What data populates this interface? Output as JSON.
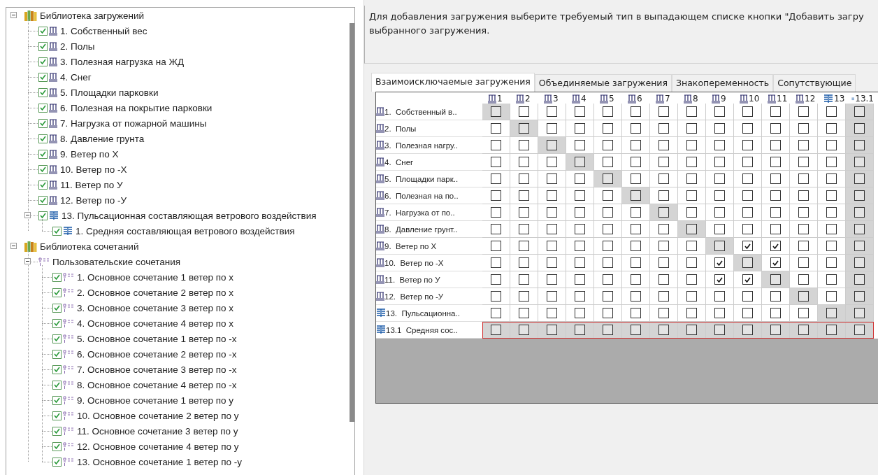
{
  "tree": [
    {
      "label": "Библиотека загружений",
      "kind": "library",
      "expanded": true,
      "children": [
        {
          "label": "1. Собственный вес",
          "kind": "load",
          "checked": true
        },
        {
          "label": "2. Полы",
          "kind": "load",
          "checked": true
        },
        {
          "label": "3. Полезная нагрузка на ЖД",
          "kind": "load",
          "checked": true
        },
        {
          "label": "4. Снег",
          "kind": "load",
          "checked": true
        },
        {
          "label": "5. Площадки парковки",
          "kind": "load",
          "checked": true
        },
        {
          "label": "6. Полезная на покрытие парковки",
          "kind": "load",
          "checked": true
        },
        {
          "label": "7. Нагрузка от пожарной машины",
          "kind": "load",
          "checked": true
        },
        {
          "label": "8. Давление грунта",
          "kind": "load",
          "checked": true
        },
        {
          "label": "9. Ветер по X",
          "kind": "load",
          "checked": true
        },
        {
          "label": "10. Ветер по -X",
          "kind": "load",
          "checked": true
        },
        {
          "label": "11. Ветер по У",
          "kind": "load",
          "checked": true
        },
        {
          "label": "12. Ветер по -У",
          "kind": "load",
          "checked": true
        },
        {
          "label": "13. Пульсационная составляющая ветрового воздействия",
          "kind": "pulse",
          "checked": true,
          "expanded": true,
          "children": [
            {
              "label": "1. Средняя составляющая ветрового воздействия",
              "kind": "pulse",
              "checked": true
            }
          ]
        }
      ]
    },
    {
      "label": "Библиотека сочетаний",
      "kind": "library",
      "expanded": true,
      "children": [
        {
          "label": "Пользовательские сочетания",
          "kind": "combo",
          "expanded": true,
          "children": [
            {
              "label": "1. Основное сочетание 1 ветер по х",
              "kind": "combo",
              "checked": true
            },
            {
              "label": "2. Основное сочетание 2 ветер по х",
              "kind": "combo",
              "checked": true
            },
            {
              "label": "3. Основное сочетание 3 ветер по х",
              "kind": "combo",
              "checked": true
            },
            {
              "label": "4. Основное сочетание 4 ветер по х",
              "kind": "combo",
              "checked": true
            },
            {
              "label": "5. Основное сочетание 1 ветер по -х",
              "kind": "combo",
              "checked": true
            },
            {
              "label": "6. Основное сочетание 2 ветер по -х",
              "kind": "combo",
              "checked": true
            },
            {
              "label": "7. Основное сочетание 3 ветер по -х",
              "kind": "combo",
              "checked": true
            },
            {
              "label": "8. Основное сочетание 4 ветер по -х",
              "kind": "combo",
              "checked": true
            },
            {
              "label": "9. Основное сочетание 1 ветер по у",
              "kind": "combo",
              "checked": true
            },
            {
              "label": "10. Основное сочетание 2 ветер по у",
              "kind": "combo",
              "checked": true
            },
            {
              "label": "11. Основное сочетание 3 ветер по у",
              "kind": "combo",
              "checked": true
            },
            {
              "label": "12. Основное сочетание 4 ветер по у",
              "kind": "combo",
              "checked": true
            },
            {
              "label": "13. Основное сочетание 1 ветер по -у",
              "kind": "combo",
              "checked": true
            }
          ]
        }
      ]
    }
  ],
  "hint": [
    "Для добавления загружения выберите требуемый тип в выпадающем списке кнопки \"Добавить загру",
    "выбранного загружения."
  ],
  "tabs": [
    {
      "label": "Взаимоисключаемые загружения",
      "selected": true
    },
    {
      "label": "Объединяемые загружения",
      "selected": false
    },
    {
      "label": "Знакопеременность",
      "selected": false
    },
    {
      "label": "Сопутствующие",
      "selected": false
    }
  ],
  "grid": {
    "columns": [
      {
        "label": "1",
        "kind": "load"
      },
      {
        "label": "2",
        "kind": "load"
      },
      {
        "label": "3",
        "kind": "load"
      },
      {
        "label": "4",
        "kind": "load"
      },
      {
        "label": "5",
        "kind": "load"
      },
      {
        "label": "6",
        "kind": "load"
      },
      {
        "label": "7",
        "kind": "load"
      },
      {
        "label": "8",
        "kind": "load"
      },
      {
        "label": "9",
        "kind": "load"
      },
      {
        "label": "10",
        "kind": "load"
      },
      {
        "label": "11",
        "kind": "load"
      },
      {
        "label": "12",
        "kind": "load"
      },
      {
        "label": "13",
        "kind": "pulse"
      },
      {
        "label": "13.1",
        "kind": "pulse"
      }
    ],
    "rows": [
      {
        "label": "1.  Собственный в..",
        "kind": "load",
        "highlighted": false,
        "checked": [
          false,
          false,
          false,
          false,
          false,
          false,
          false,
          false,
          false,
          false,
          false,
          false,
          false,
          false
        ],
        "disabled": [
          true,
          false,
          false,
          false,
          false,
          false,
          false,
          false,
          false,
          false,
          false,
          false,
          false,
          true
        ]
      },
      {
        "label": "2.  Полы",
        "kind": "load",
        "highlighted": false,
        "checked": [
          false,
          false,
          false,
          false,
          false,
          false,
          false,
          false,
          false,
          false,
          false,
          false,
          false,
          false
        ],
        "disabled": [
          false,
          true,
          false,
          false,
          false,
          false,
          false,
          false,
          false,
          false,
          false,
          false,
          false,
          true
        ]
      },
      {
        "label": "3.  Полезная нагру..",
        "kind": "load",
        "highlighted": false,
        "checked": [
          false,
          false,
          false,
          false,
          false,
          false,
          false,
          false,
          false,
          false,
          false,
          false,
          false,
          false
        ],
        "disabled": [
          false,
          false,
          true,
          false,
          false,
          false,
          false,
          false,
          false,
          false,
          false,
          false,
          false,
          true
        ]
      },
      {
        "label": "4.  Снег",
        "kind": "load",
        "highlighted": false,
        "checked": [
          false,
          false,
          false,
          false,
          false,
          false,
          false,
          false,
          false,
          false,
          false,
          false,
          false,
          false
        ],
        "disabled": [
          false,
          false,
          false,
          true,
          false,
          false,
          false,
          false,
          false,
          false,
          false,
          false,
          false,
          true
        ]
      },
      {
        "label": "5.  Площадки парк..",
        "kind": "load",
        "highlighted": false,
        "checked": [
          false,
          false,
          false,
          false,
          false,
          false,
          false,
          false,
          false,
          false,
          false,
          false,
          false,
          false
        ],
        "disabled": [
          false,
          false,
          false,
          false,
          true,
          false,
          false,
          false,
          false,
          false,
          false,
          false,
          false,
          true
        ]
      },
      {
        "label": "6.  Полезная на по..",
        "kind": "load",
        "highlighted": false,
        "checked": [
          false,
          false,
          false,
          false,
          false,
          false,
          false,
          false,
          false,
          false,
          false,
          false,
          false,
          false
        ],
        "disabled": [
          false,
          false,
          false,
          false,
          false,
          true,
          false,
          false,
          false,
          false,
          false,
          false,
          false,
          true
        ]
      },
      {
        "label": "7.  Нагрузка от по..",
        "kind": "load",
        "highlighted": false,
        "checked": [
          false,
          false,
          false,
          false,
          false,
          false,
          false,
          false,
          false,
          false,
          false,
          false,
          false,
          false
        ],
        "disabled": [
          false,
          false,
          false,
          false,
          false,
          false,
          true,
          false,
          false,
          false,
          false,
          false,
          false,
          true
        ]
      },
      {
        "label": "8.  Давление грунт..",
        "kind": "load",
        "highlighted": false,
        "checked": [
          false,
          false,
          false,
          false,
          false,
          false,
          false,
          false,
          false,
          false,
          false,
          false,
          false,
          false
        ],
        "disabled": [
          false,
          false,
          false,
          false,
          false,
          false,
          false,
          true,
          false,
          false,
          false,
          false,
          false,
          true
        ]
      },
      {
        "label": "9.  Ветер по X",
        "kind": "load",
        "highlighted": false,
        "checked": [
          false,
          false,
          false,
          false,
          false,
          false,
          false,
          false,
          false,
          true,
          true,
          false,
          false,
          false
        ],
        "disabled": [
          false,
          false,
          false,
          false,
          false,
          false,
          false,
          false,
          true,
          false,
          false,
          false,
          false,
          true
        ]
      },
      {
        "label": "10.  Ветер по -X",
        "kind": "load",
        "highlighted": false,
        "checked": [
          false,
          false,
          false,
          false,
          false,
          false,
          false,
          false,
          true,
          false,
          true,
          false,
          false,
          false
        ],
        "disabled": [
          false,
          false,
          false,
          false,
          false,
          false,
          false,
          false,
          false,
          true,
          false,
          false,
          false,
          true
        ]
      },
      {
        "label": "11.  Ветер по У",
        "kind": "load",
        "highlighted": false,
        "checked": [
          false,
          false,
          false,
          false,
          false,
          false,
          false,
          false,
          true,
          true,
          false,
          false,
          false,
          false
        ],
        "disabled": [
          false,
          false,
          false,
          false,
          false,
          false,
          false,
          false,
          false,
          false,
          true,
          false,
          false,
          true
        ]
      },
      {
        "label": "12.  Ветер по -У",
        "kind": "load",
        "highlighted": false,
        "checked": [
          false,
          false,
          false,
          false,
          false,
          false,
          false,
          false,
          false,
          false,
          false,
          false,
          false,
          false
        ],
        "disabled": [
          false,
          false,
          false,
          false,
          false,
          false,
          false,
          false,
          false,
          false,
          false,
          true,
          false,
          true
        ]
      },
      {
        "label": "13.  Пульсационна..",
        "kind": "pulse",
        "highlighted": false,
        "checked": [
          false,
          false,
          false,
          false,
          false,
          false,
          false,
          false,
          false,
          false,
          false,
          false,
          false,
          false
        ],
        "disabled": [
          false,
          false,
          false,
          false,
          false,
          false,
          false,
          false,
          false,
          false,
          false,
          false,
          true,
          true
        ]
      },
      {
        "label": "13.1  Средняя сос..",
        "kind": "pulse",
        "highlighted": true,
        "checked": [
          false,
          false,
          false,
          false,
          false,
          false,
          false,
          false,
          false,
          false,
          false,
          false,
          false,
          false
        ],
        "disabled": [
          true,
          true,
          true,
          true,
          true,
          true,
          true,
          true,
          true,
          true,
          true,
          true,
          true,
          true
        ]
      }
    ]
  }
}
